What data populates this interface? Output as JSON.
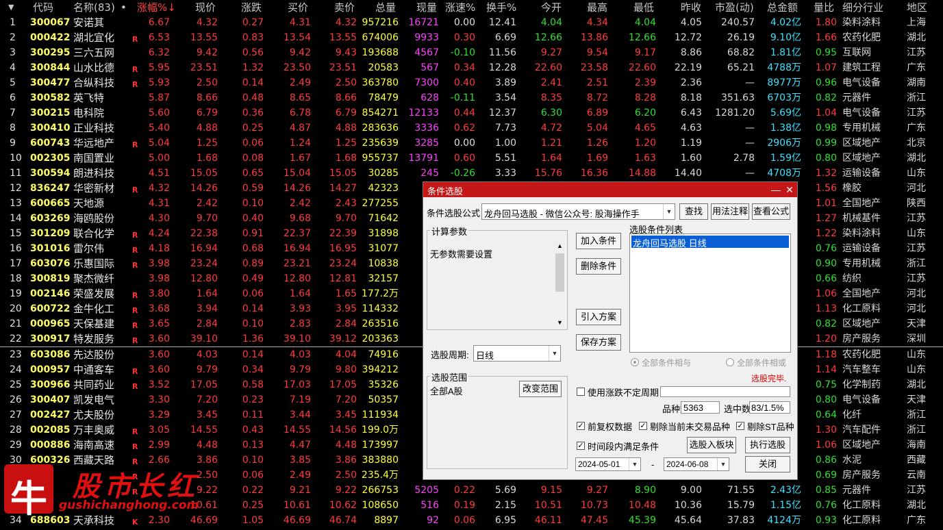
{
  "header": {
    "sort_arrow": "▼",
    "columns": [
      "代码",
      "名称(83)",
      "•",
      "涨幅%↓",
      "现价",
      "涨跌",
      "买价",
      "卖价",
      "总量",
      "现量",
      "涨速%",
      "换手%",
      "今开",
      "最高",
      "最低",
      "昨收",
      "市盈(动)",
      "总金额",
      "量比",
      "细分行业",
      "地区"
    ]
  },
  "rows": [
    [
      "1",
      "300067",
      "安诺其",
      "",
      "6.67",
      "4.32",
      "0.27",
      "4.31",
      "4.32",
      "957216",
      "16721",
      "0.00",
      "12.41",
      "4.04",
      "4.34",
      "4.04",
      "4.05",
      "240.57",
      "4.02亿",
      "1.80",
      "染料涂料",
      "上海"
    ],
    [
      "2",
      "000422",
      "湖北宜化",
      "R",
      "6.53",
      "13.55",
      "0.83",
      "13.54",
      "13.55",
      "674006",
      "9933",
      "0.30",
      "6.69",
      "12.66",
      "13.86",
      "12.66",
      "12.72",
      "26.19",
      "9.10亿",
      "1.66",
      "农药化肥",
      "湖北"
    ],
    [
      "3",
      "300295",
      "三六五网",
      "",
      "6.32",
      "9.42",
      "0.56",
      "9.42",
      "9.43",
      "193688",
      "4567",
      "-0.10",
      "11.56",
      "9.27",
      "9.54",
      "9.17",
      "8.86",
      "68.82",
      "1.81亿",
      "0.95",
      "互联网",
      "江苏"
    ],
    [
      "4",
      "300844",
      "山水比德",
      "R",
      "5.95",
      "23.51",
      "1.32",
      "23.50",
      "23.51",
      "20583",
      "567",
      "0.34",
      "12.28",
      "22.60",
      "23.58",
      "22.60",
      "22.19",
      "65.21",
      "4788万",
      "1.07",
      "建筑工程",
      "广东"
    ],
    [
      "5",
      "300477",
      "合纵科技",
      "R",
      "5.93",
      "2.50",
      "0.14",
      "2.49",
      "2.50",
      "363780",
      "7300",
      "0.40",
      "3.89",
      "2.41",
      "2.51",
      "2.39",
      "2.36",
      "—",
      "8977万",
      "0.96",
      "电气设备",
      "湖南"
    ],
    [
      "6",
      "300582",
      "英飞特",
      "",
      "5.87",
      "8.66",
      "0.48",
      "8.65",
      "8.66",
      "78479",
      "628",
      "-0.11",
      "3.54",
      "8.35",
      "8.72",
      "8.28",
      "8.18",
      "351.63",
      "6703万",
      "0.82",
      "元器件",
      "浙江"
    ],
    [
      "7",
      "300215",
      "电科院",
      "",
      "5.60",
      "6.79",
      "0.36",
      "6.78",
      "6.79",
      "854271",
      "12133",
      "0.44",
      "12.37",
      "6.30",
      "6.89",
      "6.20",
      "6.43",
      "1281.20",
      "5.69亿",
      "1.04",
      "电气设备",
      "江苏"
    ],
    [
      "8",
      "300410",
      "正业科技",
      "",
      "5.40",
      "4.88",
      "0.25",
      "4.87",
      "4.88",
      "283636",
      "3336",
      "0.62",
      "7.73",
      "4.72",
      "5.04",
      "4.65",
      "4.63",
      "—",
      "1.38亿",
      "0.98",
      "专用机械",
      "广东"
    ],
    [
      "9",
      "600743",
      "华远地产",
      "R",
      "5.04",
      "1.25",
      "0.06",
      "1.24",
      "1.25",
      "235639",
      "3285",
      "0.00",
      "1.00",
      "1.21",
      "1.26",
      "1.20",
      "1.19",
      "—",
      "2906万",
      "0.99",
      "区域地产",
      "北京"
    ],
    [
      "10",
      "002305",
      "南国置业",
      "",
      "5.00",
      "1.68",
      "0.08",
      "1.67",
      "1.68",
      "955737",
      "13791",
      "0.60",
      "5.51",
      "1.64",
      "1.69",
      "1.63",
      "1.60",
      "2.78",
      "1.59亿",
      "0.80",
      "区域地产",
      "湖北"
    ],
    [
      "11",
      "300594",
      "朗进科技",
      "",
      "4.51",
      "15.05",
      "0.65",
      "15.04",
      "15.05",
      "30285",
      "245",
      "-0.26",
      "3.33",
      "15.76",
      "16.36",
      "14.88",
      "14.40",
      "—",
      "4708万",
      "1.32",
      "运输设备",
      "山东"
    ],
    [
      "12",
      "836247",
      "华密新材",
      "R",
      "4.32",
      "14.26",
      "0.59",
      "14.26",
      "14.27",
      "42323",
      "",
      "",
      "",
      "",
      "",
      "",
      "",
      "",
      "",
      "1.56",
      "橡胶",
      "河北"
    ],
    [
      "13",
      "600665",
      "天地源",
      "",
      "4.31",
      "2.42",
      "0.10",
      "2.42",
      "2.43",
      "277255",
      "",
      "",
      "",
      "",
      "",
      "",
      "",
      "",
      "",
      "1.01",
      "全国地产",
      "陕西"
    ],
    [
      "14",
      "603269",
      "海鸥股份",
      "",
      "4.30",
      "9.70",
      "0.40",
      "9.68",
      "9.70",
      "71642",
      "",
      "",
      "",
      "",
      "",
      "",
      "",
      "",
      "",
      "1.27",
      "机械基件",
      "江苏"
    ],
    [
      "15",
      "301209",
      "联合化学",
      "R",
      "4.24",
      "22.38",
      "0.91",
      "22.37",
      "22.39",
      "31898",
      "",
      "",
      "",
      "",
      "",
      "",
      "",
      "",
      "",
      "1.22",
      "染料涂料",
      "山东"
    ],
    [
      "16",
      "301016",
      "雷尔伟",
      "R",
      "4.18",
      "16.94",
      "0.68",
      "16.94",
      "16.95",
      "31077",
      "",
      "",
      "",
      "",
      "",
      "",
      "",
      "",
      "",
      "0.76",
      "运输设备",
      "江苏"
    ],
    [
      "17",
      "603076",
      "乐惠国际",
      "R",
      "3.98",
      "23.24",
      "0.89",
      "23.21",
      "23.24",
      "10838",
      "",
      "",
      "",
      "",
      "",
      "",
      "",
      "",
      "",
      "0.90",
      "专用机械",
      "浙江"
    ],
    [
      "18",
      "300819",
      "聚杰微纤",
      "",
      "3.98",
      "12.80",
      "0.49",
      "12.80",
      "12.81",
      "32157",
      "1",
      "",
      "",
      "",
      "",
      "",
      "",
      "",
      "",
      "0.66",
      "纺织",
      "江苏"
    ],
    [
      "19",
      "002146",
      "荣盛发展",
      "R",
      "3.80",
      "1.64",
      "0.06",
      "1.64",
      "1.65",
      "177.2万",
      "15",
      "",
      "",
      "",
      "",
      "",
      "",
      "",
      "",
      "1.06",
      "全国地产",
      "河北"
    ],
    [
      "20",
      "600722",
      "金牛化工",
      "R",
      "3.68",
      "3.94",
      "0.14",
      "3.93",
      "3.95",
      "114332",
      "",
      "",
      "",
      "",
      "",
      "",
      "",
      "",
      "",
      "1.13",
      "化工原料",
      "河北"
    ],
    [
      "21",
      "000965",
      "天保基建",
      "R",
      "3.65",
      "2.84",
      "0.10",
      "2.83",
      "2.84",
      "263516",
      "",
      "",
      "",
      "",
      "",
      "",
      "",
      "",
      "",
      "0.82",
      "区域地产",
      "天津"
    ],
    [
      "22",
      "300917",
      "特发服务",
      "R",
      "3.60",
      "39.10",
      "1.36",
      "39.10",
      "39.12",
      "203363",
      "3",
      "",
      "",
      "",
      "",
      "",
      "",
      "",
      "",
      "1.20",
      "房产服务",
      "深圳"
    ],
    [
      "23",
      "603086",
      "先达股份",
      "",
      "3.60",
      "4.03",
      "0.14",
      "4.03",
      "4.04",
      "74916",
      "",
      "",
      "",
      "",
      "",
      "",
      "",
      "",
      "",
      "1.18",
      "农药化肥",
      "山东"
    ],
    [
      "24",
      "000957",
      "中通客车",
      "R",
      "3.60",
      "9.79",
      "0.34",
      "9.79",
      "9.80",
      "394212",
      "8",
      "",
      "",
      "",
      "",
      "",
      "",
      "",
      "",
      "1.14",
      "汽车整车",
      "山东"
    ],
    [
      "25",
      "300966",
      "共同药业",
      "R",
      "3.52",
      "17.05",
      "0.58",
      "17.03",
      "17.05",
      "35326",
      "",
      "",
      "",
      "",
      "",
      "",
      "",
      "",
      "",
      "0.75",
      "化学制药",
      "湖北"
    ],
    [
      "26",
      "300407",
      "凯发电气",
      "",
      "3.30",
      "7.20",
      "0.23",
      "7.19",
      "7.20",
      "50357",
      "",
      "",
      "",
      "",
      "",
      "",
      "",
      "",
      "",
      "0.80",
      "电气设备",
      "天津"
    ],
    [
      "27",
      "002427",
      "尤夫股份",
      "",
      "3.29",
      "3.45",
      "0.11",
      "3.44",
      "3.45",
      "111934",
      "",
      "",
      "",
      "",
      "",
      "",
      "",
      "",
      "",
      "0.64",
      "化纤",
      "浙江"
    ],
    [
      "28",
      "002085",
      "万丰奥威",
      "R",
      "3.05",
      "14.55",
      "0.43",
      "14.55",
      "14.56",
      "199.0万",
      "26",
      "",
      "",
      "",
      "",
      "",
      "",
      "",
      "",
      "1.30",
      "汽车配件",
      "浙江"
    ],
    [
      "29",
      "000886",
      "海南高速",
      "R",
      "2.99",
      "4.48",
      "0.13",
      "4.47",
      "4.48",
      "173997",
      "1",
      "",
      "",
      "",
      "",
      "",
      "",
      "",
      "",
      "1.06",
      "区域地产",
      "海南"
    ],
    [
      "30",
      "600326",
      "西藏天路",
      "R",
      "2.66",
      "3.86",
      "0.10",
      "3.85",
      "3.86",
      "383880",
      "",
      "",
      "",
      "",
      "",
      "",
      "",
      "",
      "",
      "0.86",
      "水泥",
      "西藏"
    ],
    [
      "31",
      "",
      "",
      "R",
      "",
      "2.50",
      "0.06",
      "2.49",
      "2.50",
      "235.4万",
      "35",
      "",
      "",
      "",
      "",
      "",
      "",
      "",
      "",
      "0.69",
      "房产服务",
      "云南"
    ],
    [
      "32",
      "",
      "",
      "R",
      "",
      "9.22",
      "0.22",
      "9.21",
      "9.22",
      "266753",
      "5205",
      "0.22",
      "5.69",
      "9.15",
      "9.27",
      "8.90",
      "9.00",
      "71.55",
      "2.43亿",
      "0.85",
      "元器件",
      "江苏"
    ],
    [
      "33",
      "",
      "",
      "",
      "",
      "10.61",
      "0.25",
      "10.61",
      "10.62",
      "108650",
      "516",
      "0.19",
      "2.15",
      "10.51",
      "10.73",
      "10.48",
      "10.36",
      "15.79",
      "1.15亿",
      "0.76",
      "化工原料",
      "湖北"
    ],
    [
      "34",
      "688603",
      "天承科技",
      "K",
      "2.30",
      "46.69",
      "1.05",
      "46.69",
      "46.74",
      "8897",
      "92",
      "0.06",
      "6.95",
      "46.11",
      "47.45",
      "45.39",
      "45.64",
      "37.83",
      "4124万",
      "0.93",
      "化工原料",
      "广东"
    ]
  ],
  "dialog": {
    "title": "条件选股",
    "min_btn": "—",
    "close_btn": "✕",
    "formula_label": "条件选股公式",
    "formula_value": "龙舟回马选股 - 微信公众号: 股海操作手",
    "btn_find": "查找",
    "btn_usage": "用法注释",
    "btn_view": "查看公式",
    "params_group": "计算参数",
    "params_text": "无参数需要设置",
    "list_group": "选股条件列表",
    "list_items": [
      "龙舟回马选股 日线"
    ],
    "btn_add": "加入条件",
    "btn_delete": "删除条件",
    "btn_load": "引入方案",
    "btn_save": "保存方案",
    "period_label": "选股周期:",
    "period_value": "日线",
    "radio_and": "全部条件相与",
    "radio_or": "全部条件相或",
    "status": "选股完毕.",
    "range_group": "选股范围",
    "range_value": "全部A股",
    "btn_change_range": "改变范围",
    "use_irregular_period": "使用涨跌不定周期",
    "count_label": "品种数",
    "count_value": "5363",
    "selected_label": "选中数",
    "selected_value": "83/1.5%",
    "chk_forward": "前复权数据",
    "chk_exclude_untraded": "剔除当前未交易品种",
    "chk_exclude_st": "剔除ST品种",
    "chk_period": "时间段内满足条件",
    "btn_to_block": "选股入板块",
    "btn_execute": "执行选股",
    "date_from": "2024-05-01",
    "date_to": "2024-06-08",
    "date_sep": "-",
    "btn_close": "关闭"
  },
  "watermark": {
    "logo_char": "牛",
    "brand": "股市长红",
    "url": "gushichanghong.com"
  },
  "colors": {
    "up": "#ff3b3b",
    "down": "#30e030",
    "volume": "#ffff40",
    "current_volume": "#ff40ff",
    "amount": "#40e0ff",
    "dialog_title": "#c41818"
  }
}
